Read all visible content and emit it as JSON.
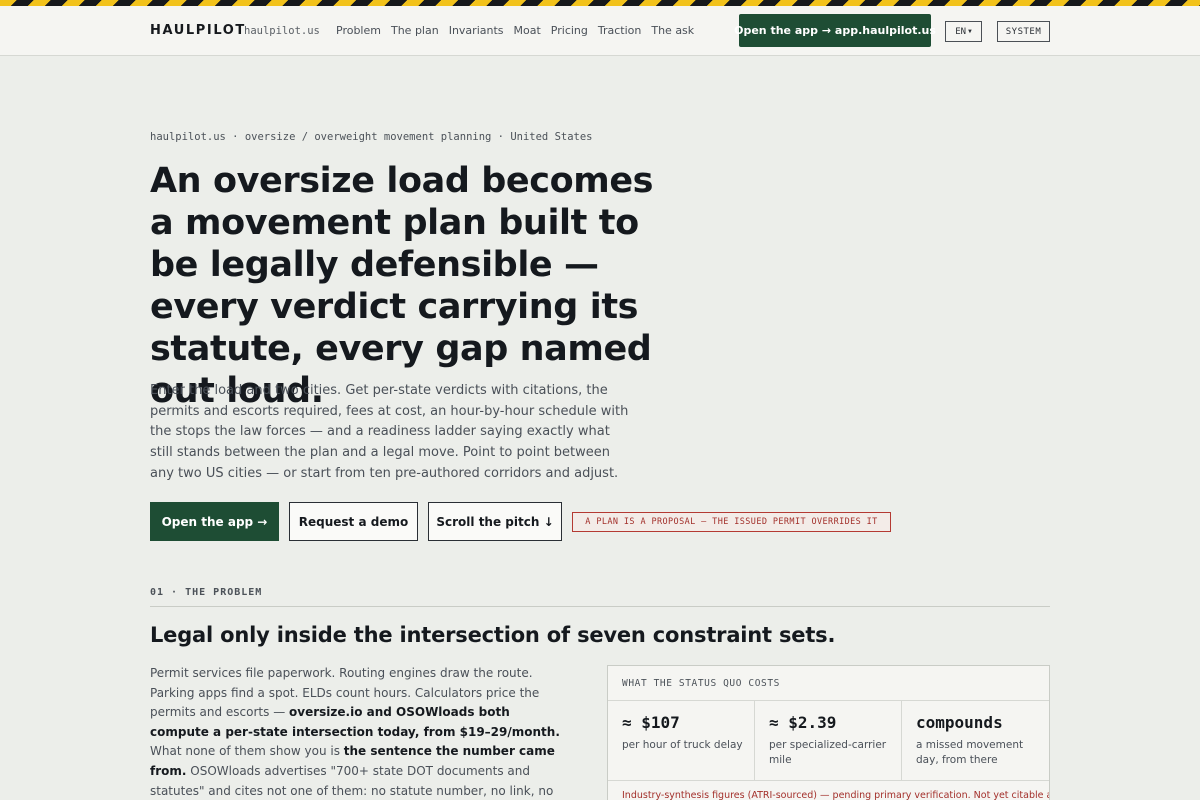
{
  "header": {
    "brand": "HAULPILOT",
    "domain": "haulpilot.us",
    "nav": [
      "Problem",
      "The plan",
      "Invariants",
      "Moat",
      "Pricing",
      "Traction",
      "The ask"
    ],
    "open_app_label": "Open the app → app.haulpilot.us",
    "lang_label": "EN",
    "theme_label": "SYSTEM"
  },
  "hero": {
    "eyebrow": "haulpilot.us · oversize / overweight movement planning · United States",
    "title": "An oversize load becomes a movement plan built to be legally defensible — every verdict carrying its statute, every gap named out loud.",
    "subtitle": "Enter the load and two cities. Get per-state verdicts with citations, the permits and escorts required, fees at cost, an hour-by-hour schedule with the stops the law forces — and a readiness ladder saying exactly what still stands between the plan and a legal move. Point to point between any two US cities — or start from ten pre-authored corridors and adjust.",
    "buttons": {
      "open_app": "Open the app →",
      "demo": "Request a demo",
      "scroll": "Scroll the pitch ↓"
    },
    "warning": "A PLAN IS A PROPOSAL — THE ISSUED PERMIT OVERRIDES IT"
  },
  "problem": {
    "label": "01 · THE PROBLEM",
    "title": "Legal only inside the intersection of seven constraint sets.",
    "p_intro": "Permit services file paperwork. Routing engines draw the route. Parking apps find a spot. ELDs count hours. Calculators price the permits and escorts — ",
    "p_bold1": "oversize.io and OSOWloads both compute a per-state intersection today, from $19–29/month.",
    "p_mid": " What none of them show you is ",
    "p_bold2": "the sentence the number came from.",
    "p_end": " OSOWloads advertises \"700+ state DOT documents and statutes\" and cites not one of them: no statute number, no link, no per-answer attribution. Today the driver or the",
    "cost_card": {
      "heading": "WHAT THE STATUS QUO COSTS",
      "items": [
        {
          "value": "≈ $107",
          "desc": "per hour of truck delay"
        },
        {
          "value": "≈ $2.39",
          "desc": "per specialized-carrier mile"
        },
        {
          "value": "compounds",
          "desc": "a missed movement day, from there"
        }
      ],
      "footnote": "Industry-synthesis figures (ATRI-sourced) — pending primary verification. Not yet citable as"
    }
  },
  "colors": {
    "accent_green": "#1e4d34",
    "warning_red": "#a3302b",
    "hazard_yellow": "#f2c21b",
    "background": "#eceeea"
  },
  "icons": {
    "lang_caret": "chevron-down-icon"
  }
}
